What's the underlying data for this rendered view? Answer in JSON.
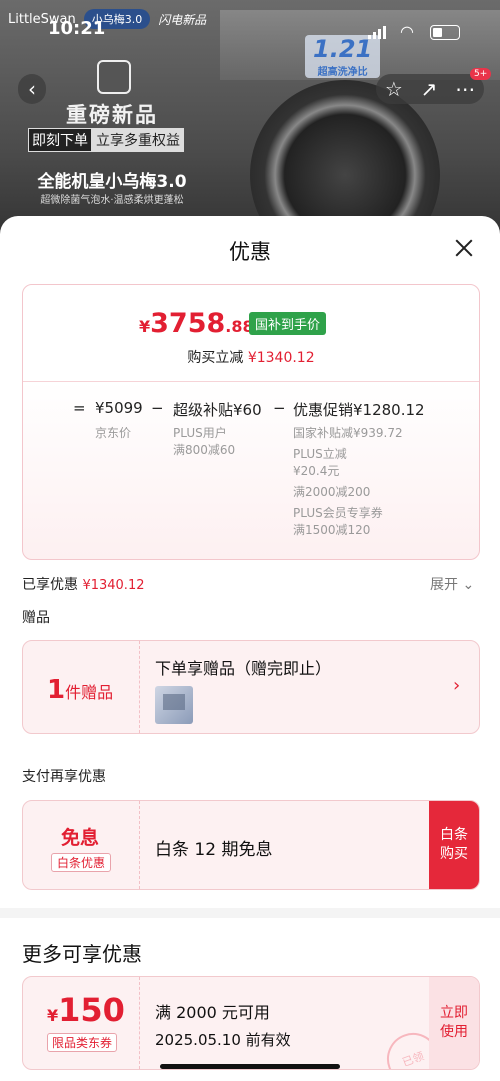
{
  "status": {
    "time": "10:21"
  },
  "background_ad": {
    "brand": "LittleSwan",
    "chip": "小乌梅3.0",
    "store": "闪电新品",
    "headline": "重磅新品",
    "tag_a": "即刻下单",
    "tag_b": "立享多重权益",
    "product": "全能机皇小乌梅3.0",
    "feature": "超微除菌气泡水·温感柔烘更蓬松",
    "slogan_num": "1.21",
    "slogan_sub": "超高洗净比",
    "cart_badge": "5+"
  },
  "sheet": {
    "title": "优惠",
    "price": {
      "yen": "¥",
      "int": "3758",
      "dec": ".88",
      "tag": "国补到手价"
    },
    "reduce_label": "购买立减",
    "reduce_value": "¥1340.12",
    "formula": {
      "eq": "=",
      "base": "¥5099",
      "base_label": "京东价",
      "minus1": "−",
      "item1": "超级补贴¥60",
      "item1_sub": [
        "PLUS用户",
        "满800减60"
      ],
      "minus2": "−",
      "item2": "优惠促销¥1280.12",
      "item2_sub": [
        "国家补贴减¥939.72",
        "PLUS立减",
        "¥20.4元",
        "满2000减200",
        "PLUS会员专享券",
        "满1500减120"
      ]
    },
    "enjoyed_label": "已享优惠",
    "enjoyed_value": "¥1340.12",
    "expand": "展开 ⌄",
    "gift_section": "赠品",
    "gift": {
      "count": "1",
      "unit": "件赠品",
      "title": "下单享赠品（赠完即止）"
    },
    "pay_section": "支付再享优惠",
    "pay": {
      "free": "免息",
      "tag": "白条优惠",
      "text": "白条 12 期免息",
      "btn1": "白条",
      "btn2": "购买"
    },
    "more_section": "更多可享优惠",
    "coupon": {
      "yen": "¥",
      "amount": "150",
      "tag": "限品类东券",
      "cond": "满 2000 元可用",
      "expire": "2025.05.10 前有效",
      "btn1": "立即",
      "btn2": "使用",
      "stamp": "已领"
    }
  }
}
